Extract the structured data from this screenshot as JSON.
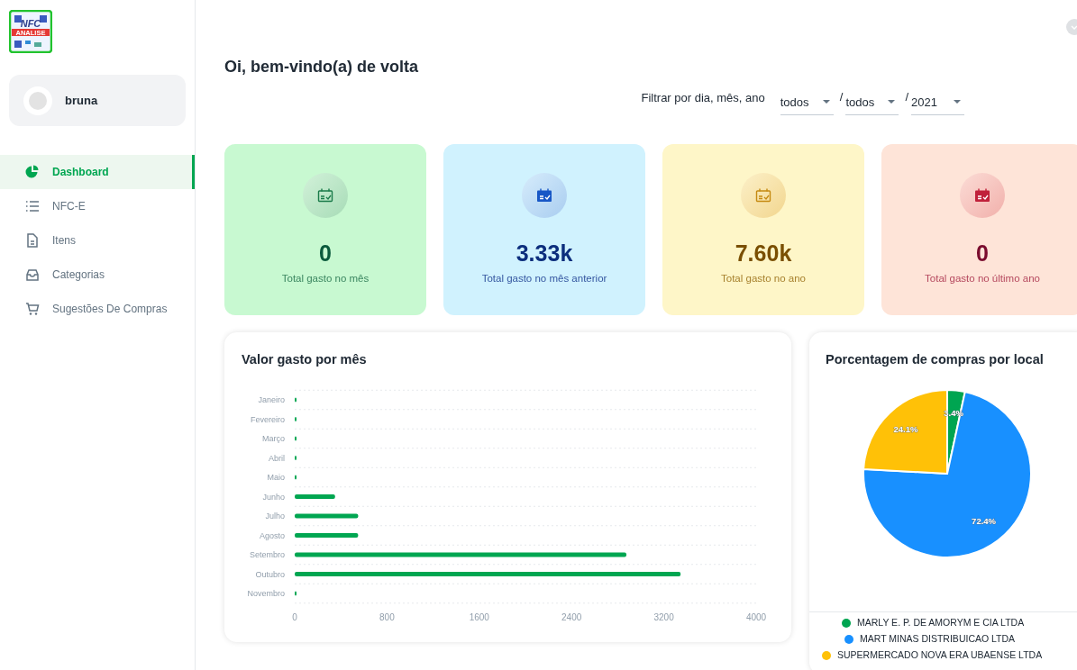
{
  "logo": {
    "line1": "NFC",
    "line2": "ANALISE"
  },
  "user": {
    "name": "bruna"
  },
  "nav": [
    {
      "label": "Dashboard",
      "kind": "pie",
      "selected": true
    },
    {
      "label": "NFC-E",
      "kind": "list",
      "selected": false
    },
    {
      "label": "Itens",
      "kind": "doc",
      "selected": false
    },
    {
      "label": "Categorias",
      "kind": "inbox",
      "selected": false
    },
    {
      "label": "Sugestões De Compras",
      "kind": "cart",
      "selected": false
    }
  ],
  "greeting": "Oi, bem-vindo(a) de volta",
  "filter": {
    "label": "Filtrar por dia, mês, ano",
    "selects": [
      {
        "value": "todos"
      },
      {
        "value": "todos",
        "separator": "/"
      },
      {
        "value": "2021",
        "separator": "/"
      }
    ]
  },
  "stats": [
    {
      "value": "0",
      "label": "Total gasto no mês",
      "kind": "green"
    },
    {
      "value": "3.33k",
      "label": "Total gasto no mês anterior",
      "kind": "blue"
    },
    {
      "value": "7.60k",
      "label": "Total gasto no ano",
      "kind": "yellow"
    },
    {
      "value": "0",
      "label": "Total gasto no último ano",
      "kind": "red"
    }
  ],
  "monthly": {
    "title": "Valor gasto por mês",
    "chart_data": {
      "type": "bar",
      "orientation": "horizontal",
      "categories": [
        "Janeiro",
        "Fevereiro",
        "Março",
        "Abril",
        "Maio",
        "Junho",
        "Julho",
        "Agosto",
        "Setembro",
        "Outubro",
        "Novembro"
      ],
      "series": [
        {
          "color": "#00a651",
          "values": [
            10,
            10,
            10,
            10,
            10,
            350,
            550,
            550,
            2875,
            3345,
            10
          ]
        }
      ],
      "xlim": [
        0,
        4000
      ],
      "xticks": [
        {
          "value": 0,
          "label": "0"
        },
        {
          "value": 800,
          "label": "800"
        },
        {
          "value": 1600,
          "label": "1600"
        },
        {
          "value": 2400,
          "label": "2400"
        },
        {
          "value": 3200,
          "label": "3200"
        },
        {
          "value": 4000,
          "label": "4000"
        }
      ]
    }
  },
  "by_store": {
    "title": "Porcentagem de compras por local",
    "chart_data": {
      "type": "pie",
      "categories": [
        "MARLY E. P. DE AMORYM E CIA LTDA",
        "MART MINAS DISTRIBUICAO LTDA",
        "SUPERMERCADO NOVA ERA UBAENSE LTDA"
      ],
      "series": [
        {
          "values": [
            3.4,
            72.4,
            24.1
          ]
        }
      ],
      "colors": [
        "#00a551",
        "#1890ff",
        "#ffc107"
      ],
      "value_labels": [
        "3.4%",
        "72.4%",
        "24.1%"
      ]
    }
  }
}
